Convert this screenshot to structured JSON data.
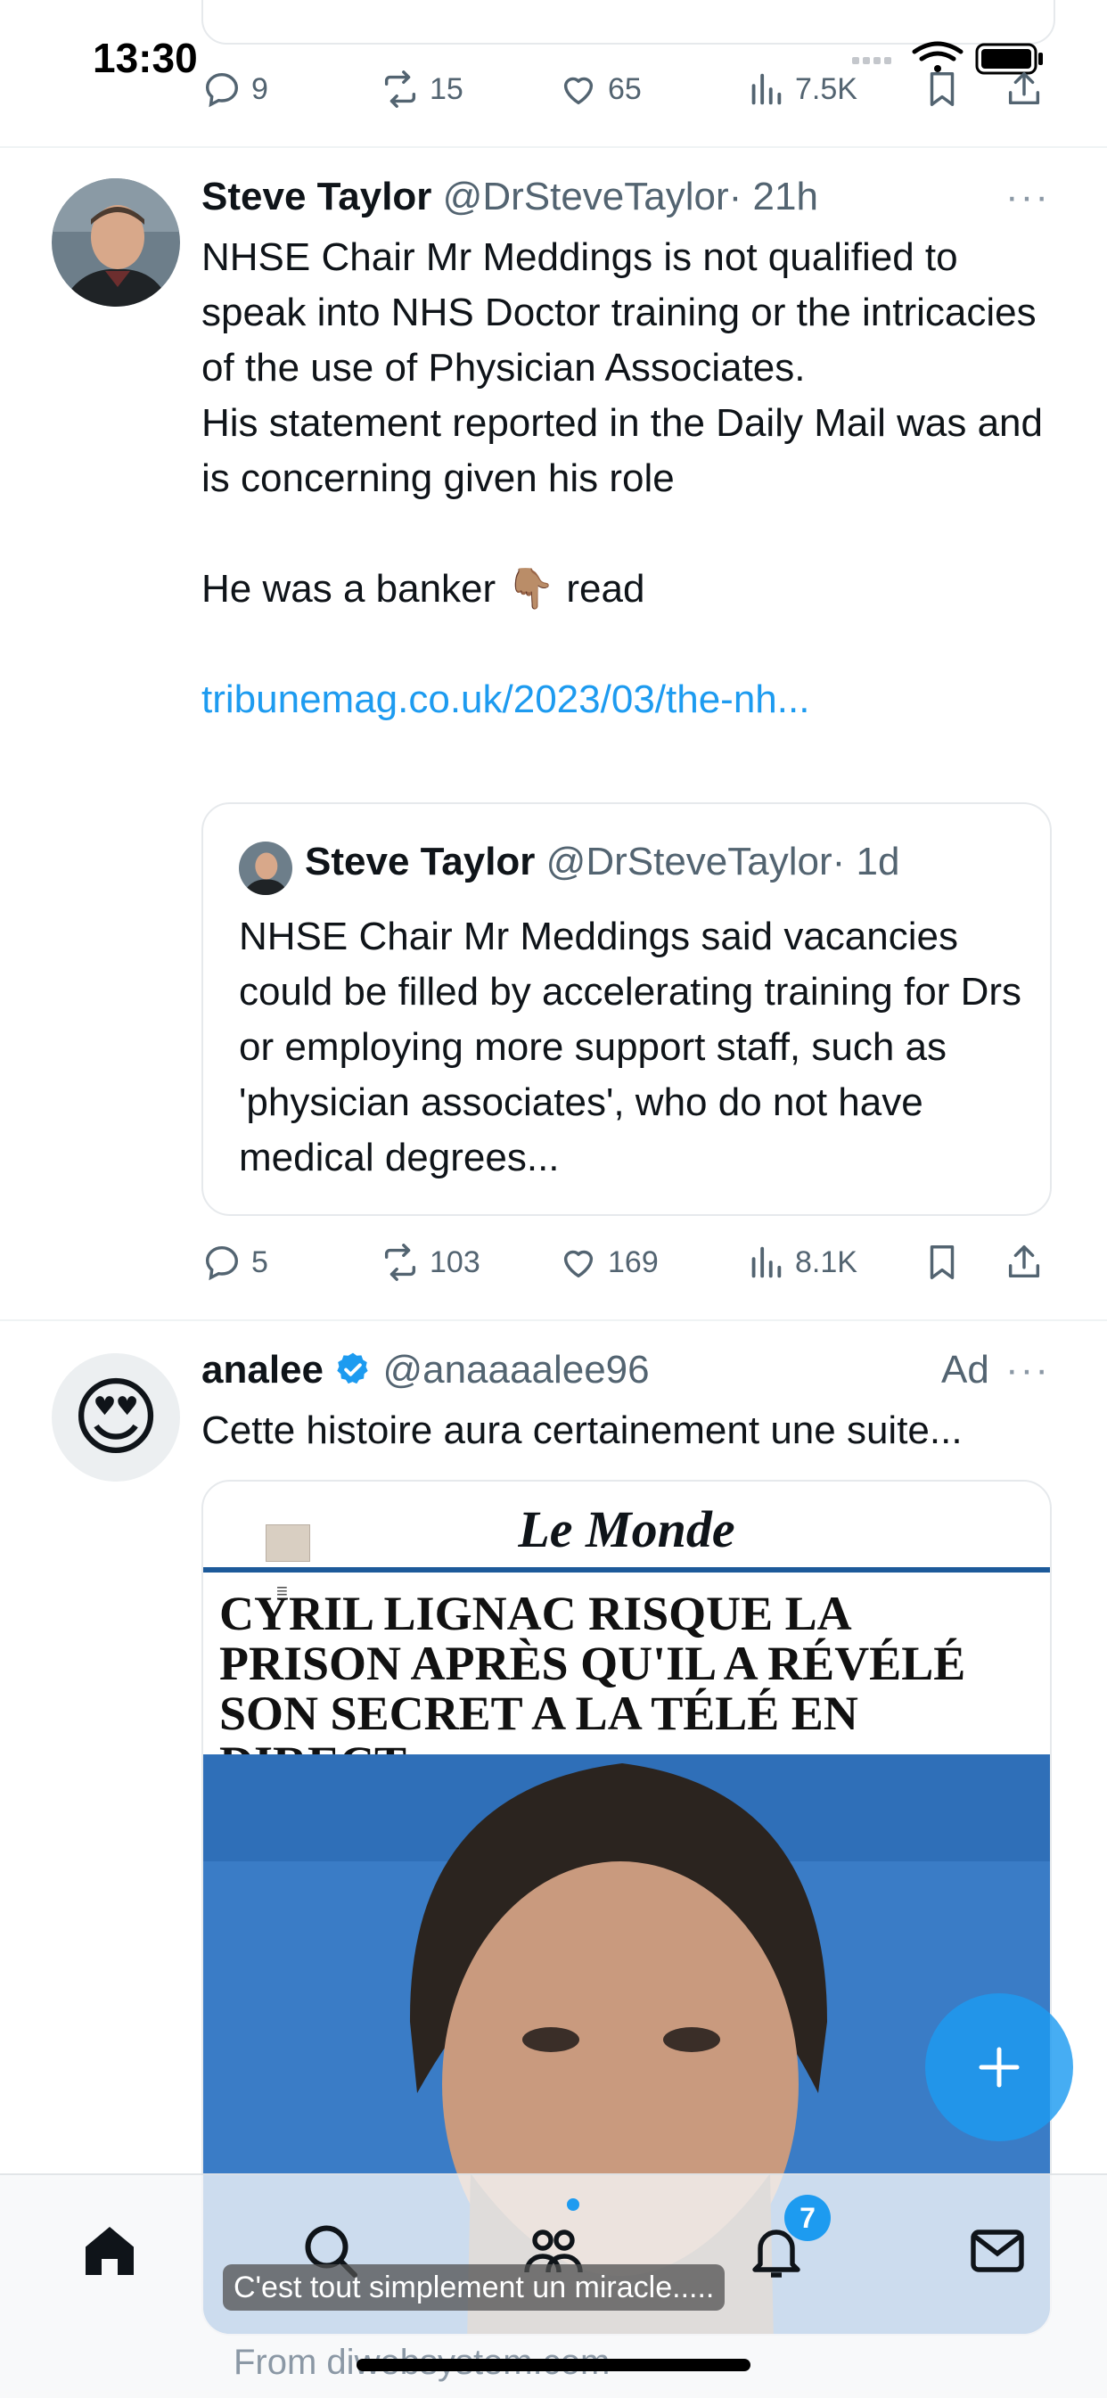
{
  "status_bar": {
    "time": "13:30"
  },
  "tweets": [
    {
      "actions": {
        "replies": "9",
        "retweets": "15",
        "likes": "65",
        "views": "7.5K"
      }
    },
    {
      "name": "Steve Taylor",
      "handle": "@DrSteveTaylor",
      "time": "· 21h",
      "more": "···",
      "body": [
        "NHSE Chair Mr Meddings is not qualified to speak into NHS Doctor training or the intricacies of the use of Physician Associates.",
        "His statement reported in the Daily Mail was and is concerning given his role",
        "He was a banker 👇🏽 read"
      ],
      "link": "tribunemag.co.uk/2023/03/the-nh...",
      "quote": {
        "name": "Steve Taylor",
        "handle": "@DrSteveTaylor",
        "time": "· 1d",
        "text": "NHSE Chair Mr Meddings said vacancies could be filled by accelerating training for Drs or employing more support staff, such as 'physician associates', who do not have medical degrees..."
      },
      "actions": {
        "replies": "5",
        "retweets": "103",
        "likes": "169",
        "views": "8.1K"
      }
    },
    {
      "name": "analee",
      "handle": "@anaaaalee96",
      "ad_label": "Ad",
      "more": "···",
      "avatar_emoji": "😍",
      "body": "Cette histoire aura certainement une suite...",
      "media": {
        "masthead": "Le Monde",
        "headline": "CYRIL LIGNAC RISQUE LA PRISON APRÈS QU'IL A RÉVÉLÉ SON SECRET A LA TÉLÉ EN DIRECT",
        "caption": "C'est tout simplement un miracle.....",
        "source": "From diwebsystem.com"
      }
    }
  ],
  "nav": {
    "notifications_badge": "7"
  },
  "colors": {
    "accent": "#1d9bf0",
    "text": "#0f1419",
    "muted": "#536471"
  }
}
